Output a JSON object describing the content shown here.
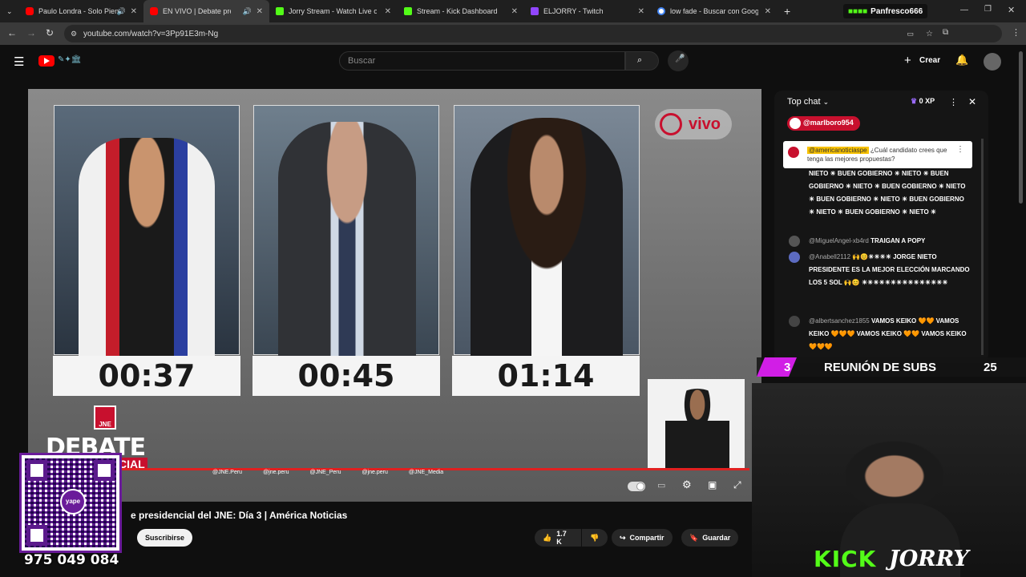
{
  "tabs": [
    {
      "title": "Paulo Londra - Solo Pienso",
      "color": "#ff0000"
    },
    {
      "title": "EN VIVO | Debate presidencial",
      "color": "#ff0000"
    },
    {
      "title": "Jorry Stream - Watch Live on Kick",
      "color": "#53fc18"
    },
    {
      "title": "Stream - Kick Dashboard",
      "color": "#53fc18"
    },
    {
      "title": "ELJORRY - Twitch",
      "color": "#9146ff"
    },
    {
      "title": "low fade - Buscar con Google",
      "color": "#4285f4"
    }
  ],
  "profile": "Panfresco666",
  "url": "youtube.com/watch?v=3Pp91E3m-Ng",
  "search_placeholder": "Buscar",
  "create_label": "Crear",
  "timers": [
    "00:37",
    "00:45",
    "01:14"
  ],
  "vivo": "vivo",
  "jne": "JNE",
  "debate_word": "DEBATE",
  "debate_sub": "CIAL",
  "socials": [
    "@JNE.Peru",
    "@jne.peru",
    "@JNE_Peru",
    "@jne.peru",
    "@JNE_Media"
  ],
  "video_title": "e presidencial del JNE: Día 3 | América Noticias",
  "subscribe": "Suscribirse",
  "likes": "1.7 K",
  "share": "Compartir",
  "save": "Guardar",
  "chat": {
    "mode": "Top chat",
    "xp": "0 XP",
    "pinned_user": "@marlboro954",
    "top_msg_user": "@americanoticiaspe",
    "top_msg_text": "¿Cuál candidato crees que tenga las mejores propuestas?",
    "messages": [
      {
        "user": "",
        "text": "NIETO ☀ BUEN GOBIERNO ☀ NIETO ☀ BUEN GOBIERNO ☀ NIETO ☀ BUEN GOBIERNO ☀ NIETO ☀ BUEN GOBIERNO ☀ NIETO ☀ BUEN GOBIERNO ☀ NIETO ☀ BUEN GOBIERNO ☀ NIETO ☀"
      },
      {
        "user": "@MiguelAngel-xb4rd",
        "text": "TRAIGAN A POPY"
      },
      {
        "user": "@Anabell2112",
        "text": "🙌😊☀☀☀☀ JORGE NIETO PRESIDENTE ES LA MEJOR ELECCIÓN MARCANDO LOS 5 SOL 🙌😊 ☀☀☀☀☀☀☀☀☀☀☀☀☀☀☀"
      },
      {
        "user": "@albertsanchez1855",
        "text": "VAMOS KEIKO 🧡🧡 VAMOS KEIKO 🧡🧡🧡 VAMOS KEIKO 🧡🧡 VAMOS KEIKO 🧡🧡🧡"
      }
    ]
  },
  "overlay": {
    "subs_count": "3",
    "subs_text": "REUNIÓN DE SUBS",
    "subs_goal": "25",
    "phone": "975 049 084",
    "yape": "yape",
    "kick": "KICK",
    "jorry": "JORRY"
  }
}
